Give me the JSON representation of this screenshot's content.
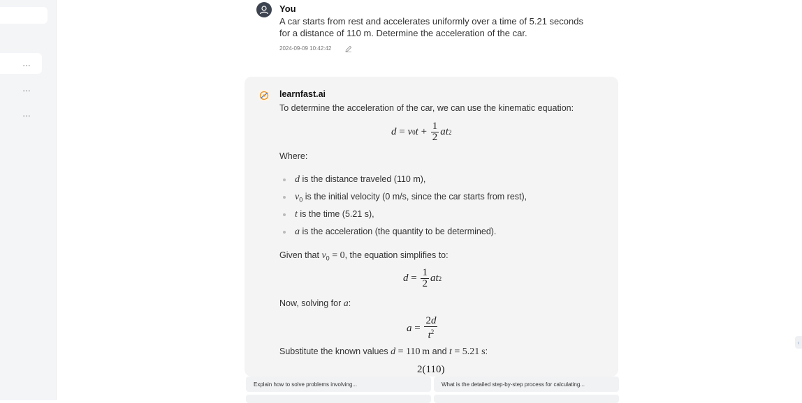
{
  "sidebar": {
    "items": [
      {
        "label": "..."
      },
      {
        "label": "..."
      },
      {
        "label": "..."
      }
    ]
  },
  "user_message": {
    "name": "You",
    "text": "A car starts from rest and accelerates uniformly over a time of 5.21 seconds for a distance of 110 m. Determine the acceleration of the car.",
    "timestamp": "2024-09-09 10:42:42"
  },
  "assistant_message": {
    "name": "learnfast.ai",
    "intro": "To determine the acceleration of the car, we can use the kinematic equation:",
    "where_label": "Where:",
    "bullets": [
      {
        "var": "d",
        "text": " is the distance traveled (110 m),"
      },
      {
        "var": "v",
        "text": " is the initial velocity (0 m/s, since the car starts from rest),"
      },
      {
        "var": "t",
        "text": " is the time (5.21 s),"
      },
      {
        "var": "a",
        "text": " is the acceleration (the quantity to be determined)."
      }
    ],
    "given_prefix": "Given that ",
    "given_suffix": ", the equation simplifies to:",
    "solving_prefix": "Now, solving for ",
    "substitute_prefix": "Substitute the known values ",
    "substitute_and": " and ",
    "substitute_suffix": ":",
    "partial_formula": "2(110)"
  },
  "suggestions": [
    {
      "text": "Explain how to solve problems involving..."
    },
    {
      "text": "What is the detailed step-by-step process for calculating..."
    },
    {
      "text": ""
    },
    {
      "text": ""
    }
  ],
  "colors": {
    "sidebar_bg": "#f4f5f7",
    "card_bg": "#f4f4f5",
    "avatar_bg": "#3d4450",
    "logo_accent": "#e8922a"
  },
  "icons": {
    "user_avatar": "user-icon",
    "edit": "pencil-icon",
    "assistant_logo": "learnfast-logo-icon"
  }
}
